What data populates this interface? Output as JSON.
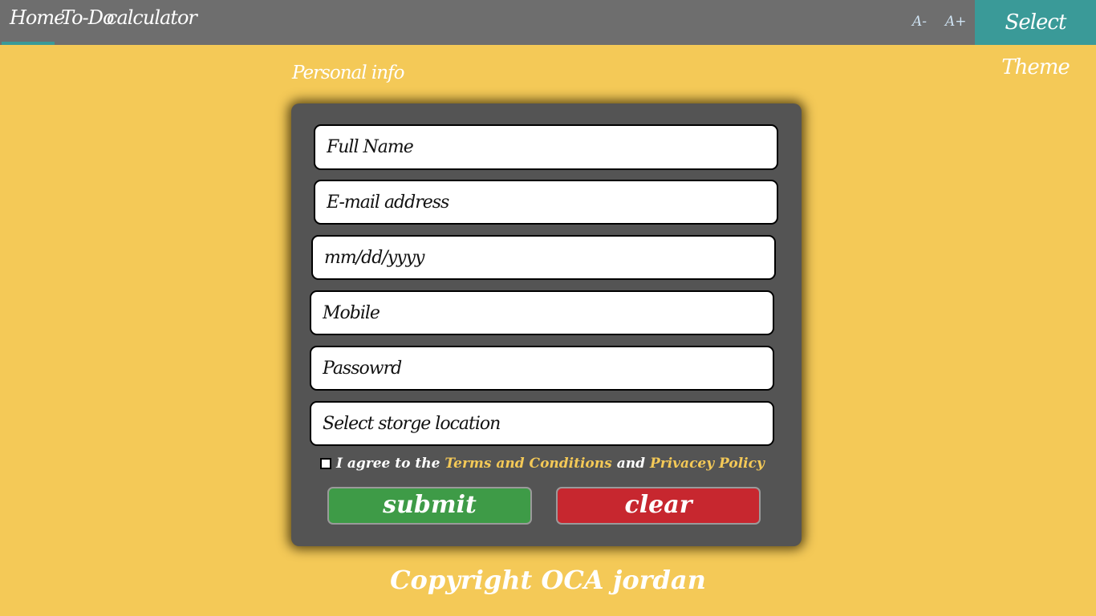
{
  "nav": {
    "links": [
      {
        "label": "Home"
      },
      {
        "label": "To-Do"
      },
      {
        "label": "calculator"
      }
    ],
    "font_decrease_label": "A-",
    "font_increase_label": "A+",
    "theme_button_label": "Select Theme"
  },
  "form": {
    "title": "Personal info",
    "fields": {
      "full_name_placeholder": "Full Name",
      "email_placeholder": "E-mail address",
      "date_placeholder": "mm/dd/yyyy",
      "mobile_placeholder": "Mobile",
      "password_placeholder": "Passowrd",
      "storage_placeholder": "Select storge location"
    },
    "agree": {
      "prefix": "I agree to the",
      "terms_link": "Terms and Conditions",
      "conjunction": "and",
      "privacy_link": "Privacey Policy",
      "checked": false
    },
    "submit_label": "submit",
    "clear_label": "clear"
  },
  "footer": {
    "copyright": "Copyright OCA jordan"
  },
  "colors": {
    "page_background": "#f4c957",
    "topbar": "#6e6e6e",
    "accent_teal": "#3a9a98",
    "card": "#545454",
    "submit_green": "#3e9b47",
    "clear_red": "#c7272f"
  }
}
